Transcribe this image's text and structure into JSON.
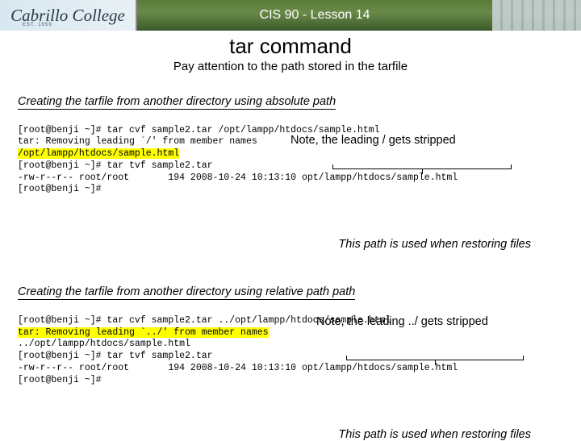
{
  "header": {
    "logo_text": "Cabrillo College",
    "logo_sub": "EST. 1959",
    "course_title": "CIS 90 - Lesson 14"
  },
  "title": "tar command",
  "subtitle": "Pay attention to the path stored in the tarfile",
  "section_a": {
    "heading": "Creating the tarfile from another directory using absolute path",
    "line1": "[root@benji ~]# tar cvf sample2.tar /opt/lampp/htdocs/sample.html",
    "line2": "tar: Removing leading `/' from member names",
    "line3_hl": "/opt/lampp/htdocs/sample.html",
    "note": "Note, the leading / gets stripped",
    "line4": "[root@benji ~]# tar tvf sample2.tar",
    "line5": "-rw-r--r-- root/root       194 2008-10-24 10:13:10 opt/lampp/htdocs/sample.html",
    "line6": "[root@benji ~]#",
    "caption": "This path is used when restoring files"
  },
  "section_b": {
    "heading": "Creating the tarfile from another directory using relative path path",
    "line1": "[root@benji ~]# tar cvf sample2.tar ../opt/lampp/htdocs/sample.html",
    "line2_hl": "tar: Removing leading `../' from member names",
    "note": "Note, the leading ../ gets stripped",
    "line3": "../opt/lampp/htdocs/sample.html",
    "line4": "[root@benji ~]# tar tvf sample2.tar",
    "line5": "-rw-r--r-- root/root       194 2008-10-24 10:13:10 opt/lampp/htdocs/sample.html",
    "line6": "[root@benji ~]#",
    "caption": "This path is used when restoring files"
  }
}
